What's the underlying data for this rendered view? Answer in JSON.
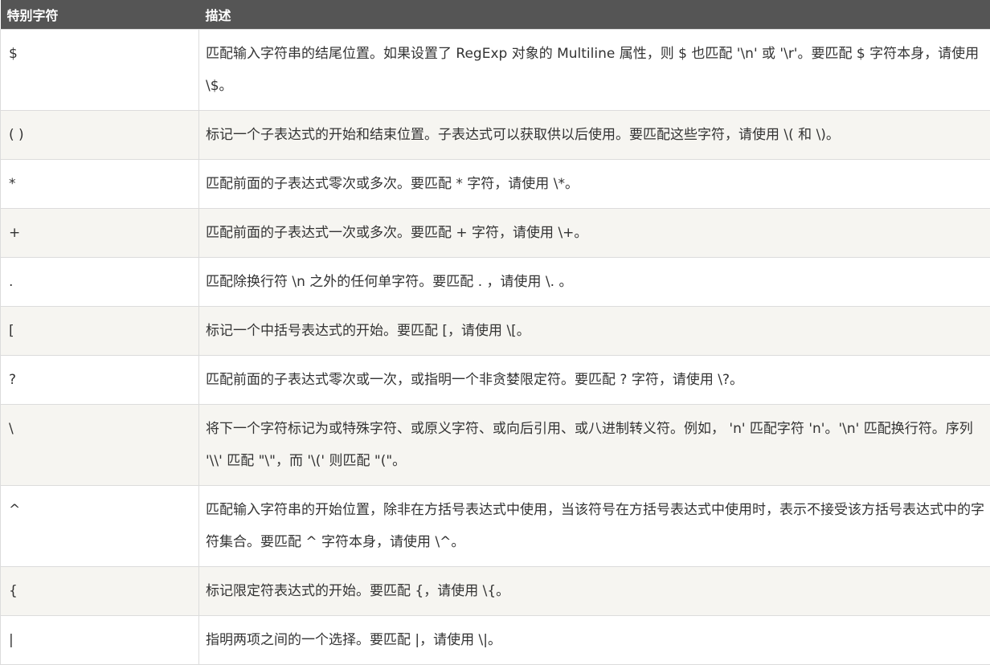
{
  "table": {
    "headers": {
      "char": "特别字符",
      "desc": "描述"
    },
    "rows": [
      {
        "char": "$",
        "desc": "匹配输入字符串的结尾位置。如果设置了 RegExp 对象的 Multiline 属性，则 $ 也匹配 '\\n' 或 '\\r'。要匹配 $ 字符本身，请使用 \\$。"
      },
      {
        "char": "( )",
        "desc": "标记一个子表达式的开始和结束位置。子表达式可以获取供以后使用。要匹配这些字符，请使用 \\( 和 \\)。"
      },
      {
        "char": "*",
        "desc": "匹配前面的子表达式零次或多次。要匹配 * 字符，请使用 \\*。"
      },
      {
        "char": "+",
        "desc": "匹配前面的子表达式一次或多次。要匹配 + 字符，请使用 \\+。"
      },
      {
        "char": ".",
        "desc": "匹配除换行符 \\n 之外的任何单字符。要匹配 . ，请使用 \\. 。"
      },
      {
        "char": "[",
        "desc": "标记一个中括号表达式的开始。要匹配 [，请使用 \\[。"
      },
      {
        "char": "?",
        "desc": "匹配前面的子表达式零次或一次，或指明一个非贪婪限定符。要匹配 ? 字符，请使用 \\?。"
      },
      {
        "char": "\\",
        "desc": "将下一个字符标记为或特殊字符、或原义字符、或向后引用、或八进制转义符。例如， 'n' 匹配字符 'n'。'\\n' 匹配换行符。序列 '\\\\' 匹配 \"\\\"，而 '\\(' 则匹配 \"(\"。"
      },
      {
        "char": "^",
        "desc": "匹配输入字符串的开始位置，除非在方括号表达式中使用，当该符号在方括号表达式中使用时，表示不接受该方括号表达式中的字符集合。要匹配 ^ 字符本身，请使用 \\^。"
      },
      {
        "char": "{",
        "desc": "标记限定符表达式的开始。要匹配 {，请使用 \\{。"
      },
      {
        "char": "|",
        "desc": "指明两项之间的一个选择。要匹配 |，请使用 \\|。"
      }
    ]
  }
}
